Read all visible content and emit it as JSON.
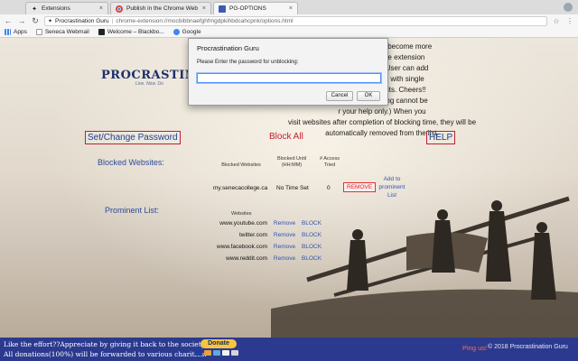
{
  "browser": {
    "tabs": [
      {
        "title": "Extensions",
        "active": false
      },
      {
        "title": "Publish in the Chrome Web St...",
        "active": false
      },
      {
        "title": "PG-OPTIONS",
        "active": true
      }
    ],
    "omnibox": {
      "site": "Procrastination Guru",
      "url": "chrome-extension://mocbibbnaefghfmgdpkihbdcahcpnk/options.html"
    },
    "bookmarks": [
      {
        "label": "Apps"
      },
      {
        "label": "Seneca Webmail"
      },
      {
        "label": "Welcome – Blackbo..."
      },
      {
        "label": "Google"
      }
    ]
  },
  "page": {
    "logo": "PROCRASTINATION",
    "logo_sub": "Live. Now. Do",
    "info_lines": [
      "help you out and become more",
      "ne click from the extension",
      "want to block it.User can add",
      "can be blocked with single",
      "nblocking websits. Cheers!!",
      "with a time setting cannot be",
      "r your help only.) When you",
      "visit websites after completion of blocking time, they will be",
      "automatically removed from the list."
    ],
    "set_password": "Set/Change Password",
    "block_all": "Block All",
    "help": "HELP",
    "blocked_label": "Blocked Websites:",
    "blocked_table": {
      "headers": [
        "Blocked Websites",
        "Blocked Until (HH:MM)",
        "# Access Tried"
      ],
      "rows": [
        {
          "site": "my.senecacollege.ca",
          "until": "No Time Set",
          "tries": "0",
          "remove": "REMOVE",
          "add": "Add to prominent List"
        }
      ]
    },
    "prominent_label": "Prominent List:",
    "prominent_header": "Websites",
    "prominent": [
      {
        "site": "www.youtube.com",
        "remove": "Remove",
        "block": "BLOCK"
      },
      {
        "site": "twitter.com",
        "remove": "Remove",
        "block": "BLOCK"
      },
      {
        "site": "www.facebook.com",
        "remove": "Remove",
        "block": "BLOCK"
      },
      {
        "site": "www.reddit.com",
        "remove": "Remove",
        "block": "BLOCK"
      }
    ]
  },
  "footer": {
    "line1": "Like the effort??Appreciate by giving it back to the society!!",
    "line2": "All donations(100%) will be forwarded to various charities.",
    "donate": "Donate",
    "ping": "Ping us!",
    "copyright": "© 2018 Procrastination Guru"
  },
  "dialog": {
    "title": "Procrastination Guru",
    "message": "Please Enter the password for unblocking:",
    "input_value": "",
    "cancel": "Cancel",
    "ok": "OK"
  },
  "colors": {
    "accent_blue": "#2c4a9a",
    "alert_red": "#c0202c",
    "footer_bg": "#2b3a8f",
    "donate_gold": "#f7c544"
  }
}
